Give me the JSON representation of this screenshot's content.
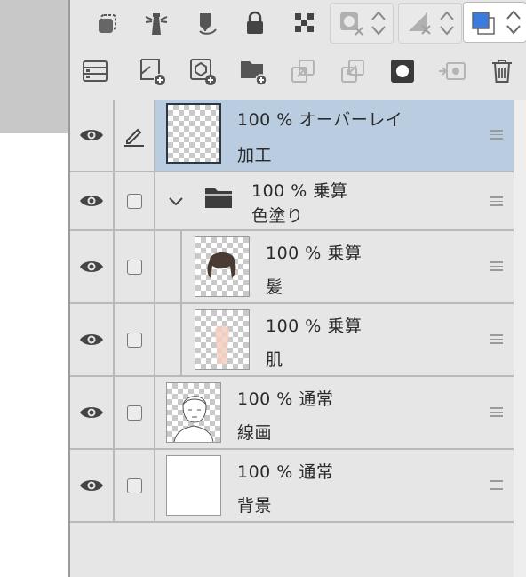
{
  "toolbar_top": {
    "icons": [
      "layer-select-icon",
      "lighthouse-icon",
      "pen-tablet-icon",
      "lock-icon",
      "checker-lock-icon",
      "mask-disabled-icon",
      "ruler-disabled-icon",
      "color-swatch-icon"
    ]
  },
  "toolbar_second": {
    "icons": [
      "layer-settings-icon",
      "new-raster-layer-icon",
      "new-vector-layer-icon",
      "new-folder-icon",
      "merge-up-icon",
      "merge-down-icon",
      "mask-icon",
      "transfer-icon",
      "trash-icon"
    ]
  },
  "colors": {
    "selected_row": "#b9cce0",
    "panel": "#e6e6e6",
    "accent_fg": "#3a7be0"
  },
  "layers": [
    {
      "opacity": "100 %",
      "blend": "オーバーレイ",
      "name": "加工",
      "selected": true,
      "edit": true
    },
    {
      "opacity": "100 %",
      "blend": "乗算",
      "name": "色塗り",
      "type": "folder",
      "expanded": true
    },
    {
      "opacity": "100 %",
      "blend": "乗算",
      "name": "髪",
      "child": true
    },
    {
      "opacity": "100 %",
      "blend": "乗算",
      "name": "肌",
      "child": true
    },
    {
      "opacity": "100 %",
      "blend": "通常",
      "name": "線画"
    },
    {
      "opacity": "100 %",
      "blend": "通常",
      "name": "背景"
    }
  ]
}
